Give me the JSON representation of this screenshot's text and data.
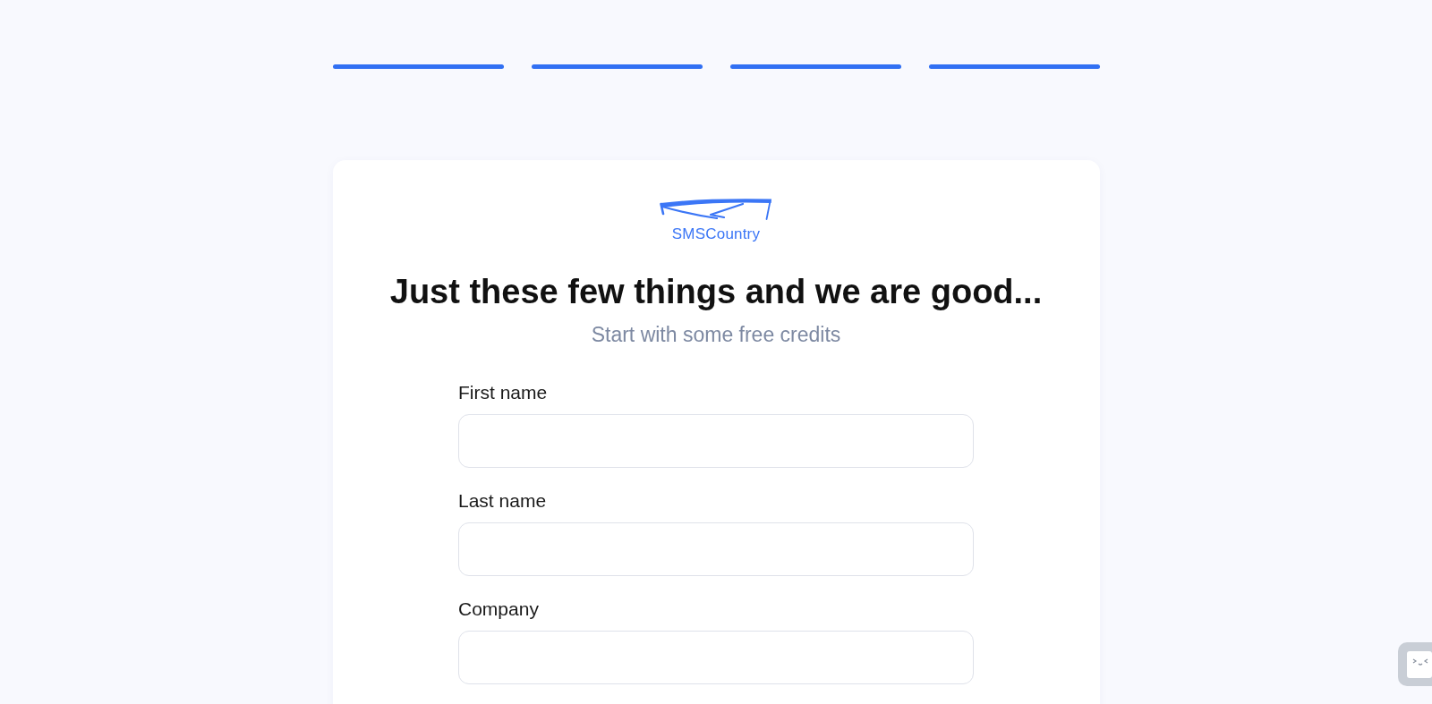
{
  "steps": [
    {
      "completed": true
    },
    {
      "completed": true
    },
    {
      "completed": true
    },
    {
      "completed": true
    }
  ],
  "logo": {
    "text": "SMSCountry"
  },
  "heading": "Just these few things and we are good...",
  "subtitle": "Start with some free credits",
  "fields": [
    {
      "label": "First name"
    },
    {
      "label": "Last name"
    },
    {
      "label": "Company"
    }
  ]
}
